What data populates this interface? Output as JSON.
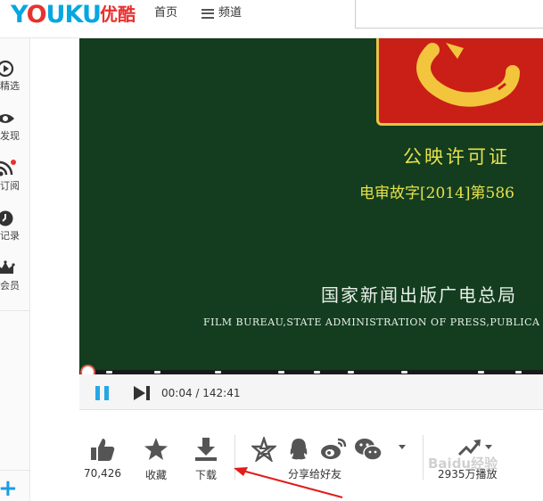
{
  "header": {
    "logo_text": "YOUKU",
    "logo_cn": "优酷",
    "nav_home": "首页",
    "nav_channel": "频道"
  },
  "sidebar": {
    "items": [
      {
        "label": "精选",
        "icon": "play-circle-icon"
      },
      {
        "label": "发现",
        "icon": "eye-icon"
      },
      {
        "label": "订阅",
        "icon": "rss-icon"
      },
      {
        "label": "记录",
        "icon": "clock-icon"
      },
      {
        "label": "会员",
        "icon": "crown-icon"
      }
    ],
    "add_label": "+"
  },
  "video": {
    "line1": "公映许可证",
    "line2": "电审故字[2014]第586",
    "line3": "国家新闻出版广电总局",
    "line4": "FILM BUREAU,STATE ADMINISTRATION OF PRESS,PUBLICA"
  },
  "player": {
    "time": "00:04 / 142:41",
    "progress_fraction": 0.0005
  },
  "actions": {
    "like_count": "70,426",
    "favorite_label": "收藏",
    "download_label": "下载",
    "share_label": "分享给好友",
    "plays_label": "2935万播放"
  },
  "watermark": "Baidu经验",
  "colors": {
    "accent": "#27a6e5",
    "brand_red": "#e8312f",
    "video_bg": "#133d1e"
  }
}
